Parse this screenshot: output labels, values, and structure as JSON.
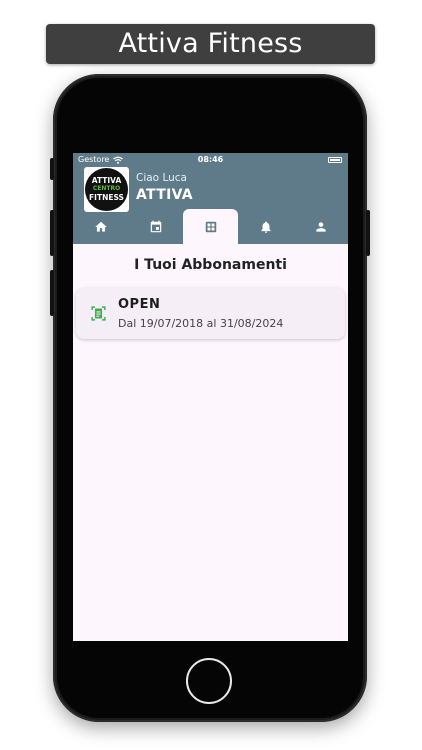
{
  "banner": {
    "title": "Attiva Fitness"
  },
  "status_bar": {
    "carrier": "Gestore",
    "time": "08:46"
  },
  "header": {
    "logo_lines": [
      "ATTIVA",
      "CENTRO",
      "FITNESS"
    ],
    "greeting": "Ciao Luca",
    "gym_name": "ATTIVA"
  },
  "tabs": [
    {
      "name": "home",
      "icon": "home-icon",
      "active": false
    },
    {
      "name": "calendar",
      "icon": "calendar-icon",
      "active": false
    },
    {
      "name": "subscriptions",
      "icon": "grid-icon",
      "active": true
    },
    {
      "name": "notifications",
      "icon": "bell-icon",
      "active": false
    },
    {
      "name": "profile",
      "icon": "person-icon",
      "active": false
    }
  ],
  "main": {
    "section_title": "I Tuoi Abbonamenti",
    "subscriptions": [
      {
        "name": "OPEN",
        "dates": "Dal 19/07/2018 al 31/08/2024",
        "icon": "card-scan-icon"
      }
    ]
  },
  "colors": {
    "header_bg": "#5f7b89",
    "screen_bg": "#fdf7fd",
    "accent_green": "#3dae4a",
    "card_bg": "#f5eef6"
  }
}
